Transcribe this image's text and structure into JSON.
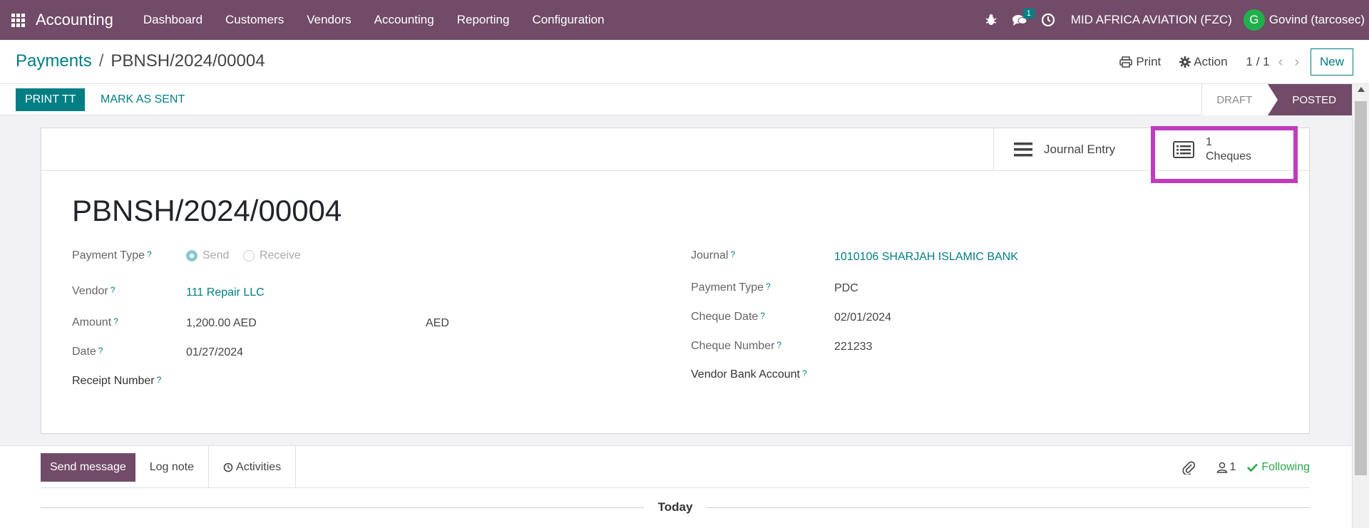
{
  "navbar": {
    "app_title": "Accounting",
    "menu": [
      "Dashboard",
      "Customers",
      "Vendors",
      "Accounting",
      "Reporting",
      "Configuration"
    ],
    "message_count": "1",
    "company": "MID AFRICA AVIATION (FZC)",
    "user_initial": "G",
    "user_name": "Govind (tarcosec)",
    "avatar_color": "#20b04b",
    "brand_color": "#714b67"
  },
  "breadcrumb": {
    "parent": "Payments",
    "separator": "/",
    "current": "PBNSH/2024/00004"
  },
  "control": {
    "print": "Print",
    "action": "Action",
    "pager": "1 / 1",
    "new": "New"
  },
  "statusbar": {
    "print_tt": "PRINT TT",
    "mark_sent": "MARK AS SENT",
    "stages": [
      "DRAFT",
      "POSTED"
    ],
    "active_stage": "POSTED"
  },
  "smart_buttons": {
    "journal_entry": "Journal Entry",
    "cheques_count": "1",
    "cheques_label": "Cheques"
  },
  "form": {
    "title": "PBNSH/2024/00004",
    "payment_type_label": "Payment Type",
    "payment_type_options": [
      "Send",
      "Receive"
    ],
    "payment_type_selected": "Send",
    "vendor_label": "Vendor",
    "vendor_value": "111 Repair LLC",
    "amount_label": "Amount",
    "amount_value": "1,200.00 AED",
    "currency_value": "AED",
    "date_label": "Date",
    "date_value": "01/27/2024",
    "receipt_label": "Receipt Number",
    "journal_label": "Journal",
    "journal_value": "1010106 SHARJAH ISLAMIC BANK",
    "pay_type2_label": "Payment Type",
    "pay_type2_value": "PDC",
    "cheque_date_label": "Cheque Date",
    "cheque_date_value": "02/01/2024",
    "cheque_number_label": "Cheque Number",
    "cheque_number_value": "221233",
    "vendor_bank_label": "Vendor Bank Account",
    "help_mark": "?"
  },
  "chatter": {
    "send_message": "Send message",
    "log_note": "Log note",
    "activities": "Activities",
    "followers_count": "1",
    "following": "Following",
    "today": "Today"
  }
}
